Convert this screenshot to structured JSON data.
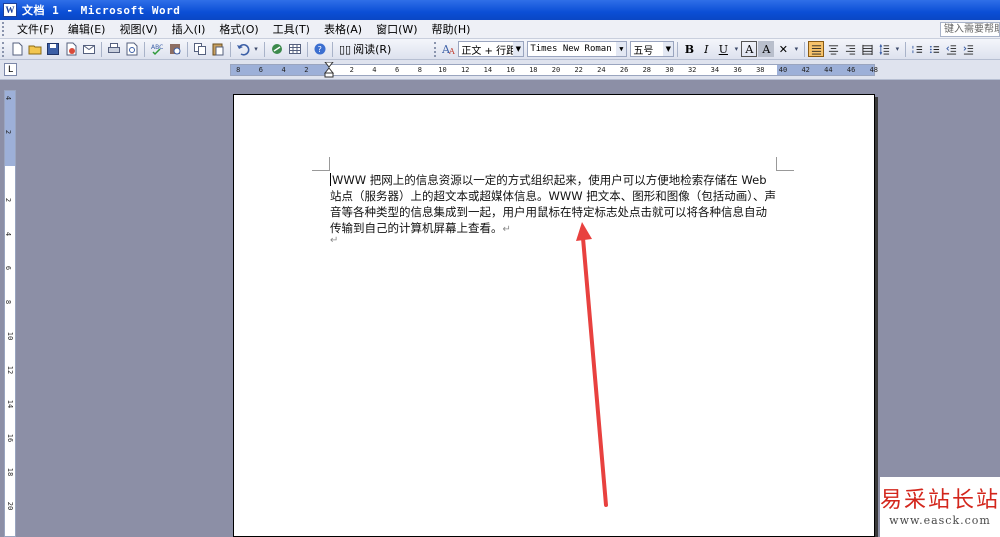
{
  "window": {
    "title": "文档 1 - Microsoft Word"
  },
  "menu": {
    "items": [
      "文件(F)",
      "编辑(E)",
      "视图(V)",
      "插入(I)",
      "格式(O)",
      "工具(T)",
      "表格(A)",
      "窗口(W)",
      "帮助(H)"
    ],
    "help_search_placeholder": "键入需要帮助"
  },
  "toolbar": {
    "read_label": "阅读(R)",
    "style_value": "正文 + 行距",
    "font_value": "Times New Roman",
    "size_value": "五号"
  },
  "rulers": {
    "horizontal_ticks": [
      "8",
      "6",
      "4",
      "2",
      "2",
      "4",
      "6",
      "8",
      "10",
      "12",
      "14",
      "16",
      "18",
      "20",
      "22",
      "24",
      "26",
      "28",
      "30",
      "32",
      "34",
      "36",
      "38",
      "40",
      "42",
      "44",
      "46",
      "48"
    ],
    "vertical_ticks": [
      "4",
      "2",
      "2",
      "4",
      "6",
      "8",
      "10",
      "12",
      "14",
      "16",
      "18",
      "20"
    ]
  },
  "document": {
    "paragraph": "WWW 把网上的信息资源以一定的方式组织起来，使用户可以方便地检索存储在 Web 站点（服务器）上的超文本或超媒体信息。WWW 把文本、图形和图像（包括动画）、声音等各种类型的信息集成到一起，用户用鼠标在特定标志处点击就可以将各种信息自动传输到自己的计算机屏幕上查看。",
    "paragraph_mark": "↵",
    "empty_paragraph_mark": "↵"
  },
  "watermark": {
    "name": "易采站长站",
    "url": "www.easck.com"
  },
  "colors": {
    "titlebar": "#0b4fd6",
    "arrow": "#e8413f",
    "workspace": "#8c8fa6"
  }
}
